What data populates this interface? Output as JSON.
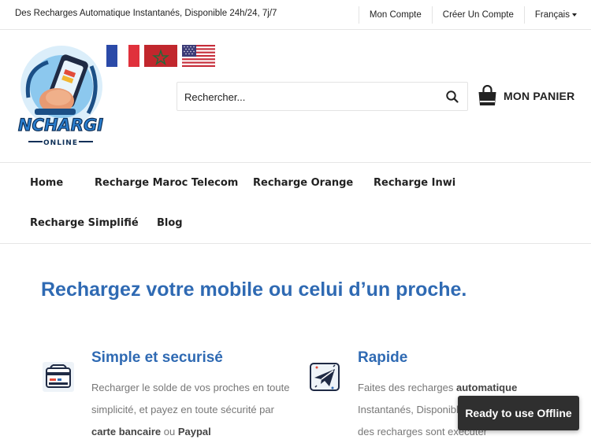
{
  "topbar": {
    "tagline": "Des Recharges Automatique Instantanés, Disponible 24h/24, 7j/7",
    "my_account": "Mon Compte",
    "create_account": "Créer Un Compte",
    "language": "Français"
  },
  "logo": {
    "text_main": "NCHARGI",
    "text_sub": "ONLINE"
  },
  "flags": [
    {
      "name": "France",
      "code": "fr"
    },
    {
      "name": "Maroc",
      "code": "ma"
    },
    {
      "name": "USA",
      "code": "us"
    }
  ],
  "search": {
    "placeholder": "Rechercher...",
    "icon": "search-icon"
  },
  "cart": {
    "label": "MON PANIER",
    "icon": "shopping-bag-icon"
  },
  "nav": {
    "items": [
      {
        "label": "Home"
      },
      {
        "label": "Recharge Maroc Telecom"
      },
      {
        "label": "Recharge Orange"
      },
      {
        "label": "Recharge Inwi"
      },
      {
        "label": "Recharge Simplifié"
      },
      {
        "label": "Blog"
      }
    ]
  },
  "hero": {
    "title": "Rechargez votre mobile ou celui d’un proche."
  },
  "features": [
    {
      "title": "Simple  et securisé",
      "icon": "credit-card-terminal-icon",
      "text_1": "Recharger le solde de vos proches en toute simplicité, et payez en toute sécurité par ",
      "bold_1": "carte bancaire",
      "text_2": " ou ",
      "bold_2": "Paypal"
    },
    {
      "title": "Rapide",
      "icon": "paper-plane-icon",
      "text_1": "Faites des recharges ",
      "bold_1": "automatique",
      "text_2": " Instantanés, Disponible 24h/24, 7j/7 et 95% des recharges sont executer"
    }
  ],
  "toast": {
    "text": "Ready to use Offline"
  },
  "colors": {
    "primary_blue": "#2f6ab3",
    "text_dark": "#222222",
    "text_grey": "#777777",
    "toast_bg": "#2f2f2f"
  }
}
